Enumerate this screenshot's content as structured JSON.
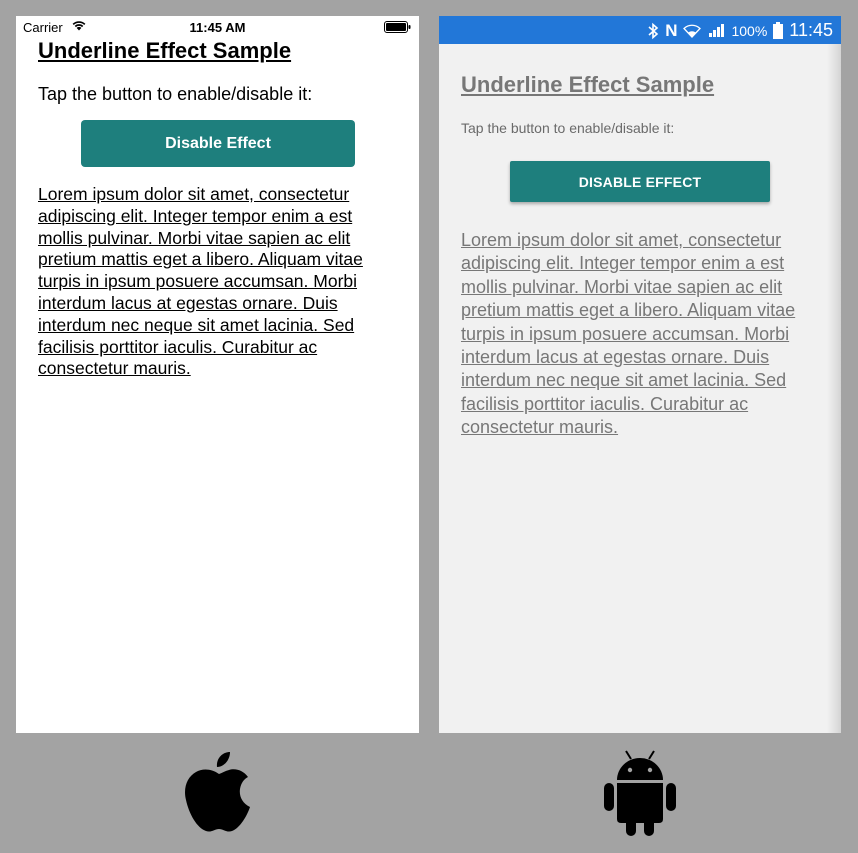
{
  "ios": {
    "status": {
      "carrier": "Carrier",
      "time": "11:45 AM"
    },
    "title": "Underline Effect Sample",
    "prompt": "Tap the button to enable/disable it:",
    "button_label": "Disable Effect",
    "lorem": "Lorem ipsum dolor sit amet, consectetur adipiscing elit. Integer tempor enim a est mollis pulvinar. Morbi vitae sapien ac elit pretium mattis eget a libero. Aliquam vitae turpis in ipsum posuere accumsan. Morbi interdum lacus at egestas ornare. Duis interdum nec neque sit amet lacinia. Sed facilisis porttitor iaculis. Curabitur ac consectetur mauris."
  },
  "android": {
    "status": {
      "network_glyph": "N",
      "battery_percent": "100%",
      "time": "11:45"
    },
    "title": "Underline Effect Sample",
    "prompt": "Tap the button to enable/disable it:",
    "button_label": "DISABLE EFFECT",
    "lorem": "Lorem ipsum dolor sit amet, consectetur adipiscing elit. Integer tempor enim a est mollis pulvinar. Morbi vitae sapien ac elit pretium mattis eget a libero. Aliquam vitae turpis in ipsum posuere accumsan. Morbi interdum lacus at egestas ornare. Duis interdum nec neque sit amet lacinia. Sed facilisis porttitor iaculis. Curabitur ac consectetur mauris."
  },
  "colors": {
    "page_background": "#a3a3a3",
    "button_teal": "#1e7f7d",
    "android_status_bar": "#2277d8",
    "android_background": "#f1f1f1"
  },
  "icons": [
    "wifi-icon",
    "battery-icon",
    "bluetooth-icon",
    "signal-icon",
    "apple-logo-icon",
    "android-logo-icon"
  ]
}
